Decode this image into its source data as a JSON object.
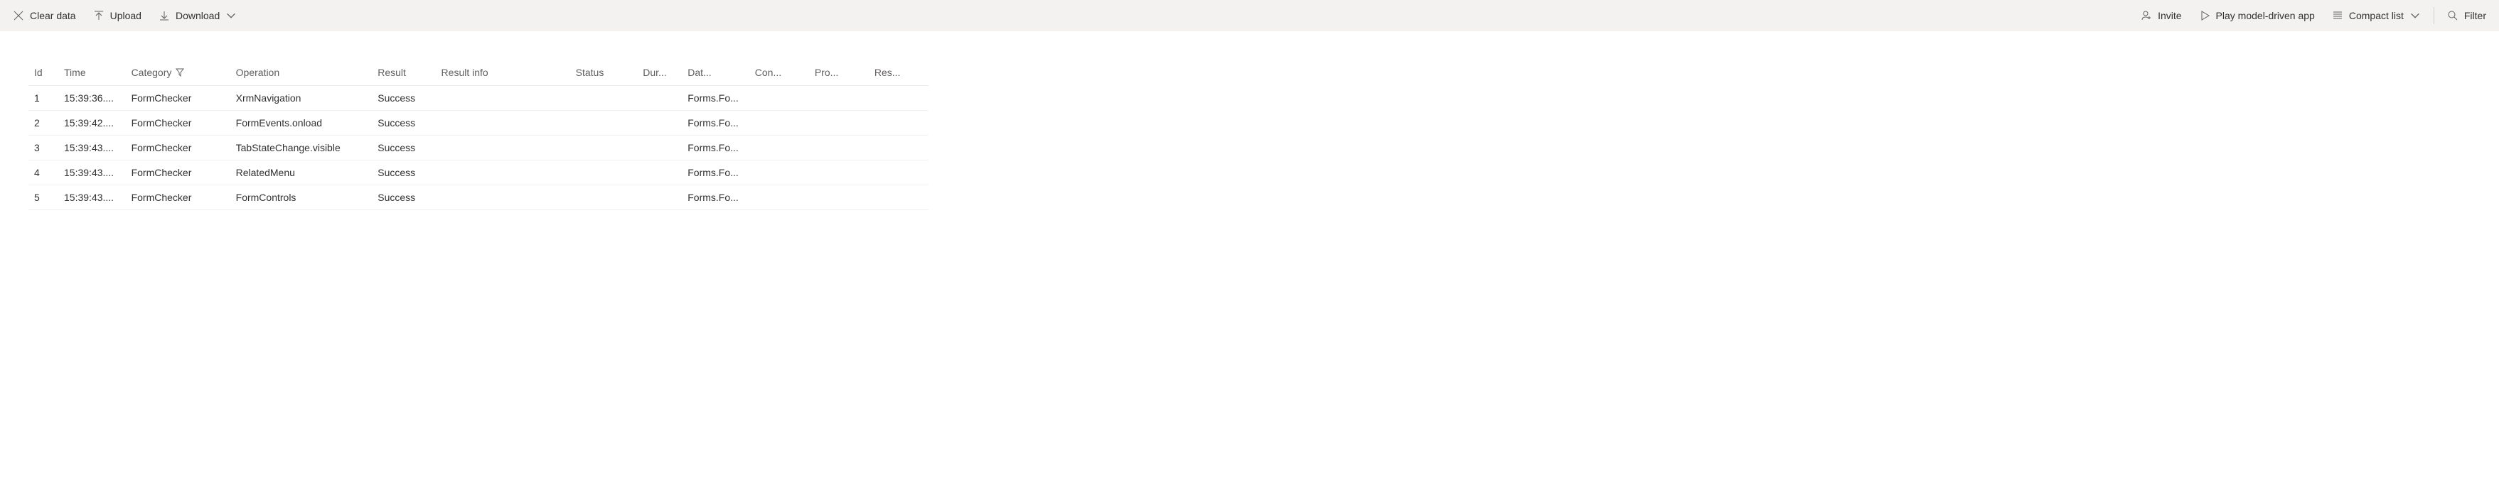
{
  "toolbar": {
    "clear_data_label": "Clear data",
    "upload_label": "Upload",
    "download_label": "Download",
    "invite_label": "Invite",
    "play_label": "Play model-driven app",
    "view_label": "Compact list",
    "filter_label": "Filter"
  },
  "table": {
    "headers": {
      "id": "Id",
      "time": "Time",
      "category": "Category",
      "operation": "Operation",
      "result": "Result",
      "result_info": "Result info",
      "status": "Status",
      "duration": "Dur...",
      "data": "Dat...",
      "con": "Con...",
      "pro": "Pro...",
      "res": "Res..."
    },
    "rows": [
      {
        "id": "1",
        "time": "15:39:36....",
        "category": "FormChecker",
        "operation": "XrmNavigation",
        "result": "Success",
        "result_info": "",
        "status": "",
        "duration": "",
        "data": "Forms.Fo...",
        "con": "",
        "pro": "",
        "res": ""
      },
      {
        "id": "2",
        "time": "15:39:42....",
        "category": "FormChecker",
        "operation": "FormEvents.onload",
        "result": "Success",
        "result_info": "",
        "status": "",
        "duration": "",
        "data": "Forms.Fo...",
        "con": "",
        "pro": "",
        "res": ""
      },
      {
        "id": "3",
        "time": "15:39:43....",
        "category": "FormChecker",
        "operation": "TabStateChange.visible",
        "result": "Success",
        "result_info": "",
        "status": "",
        "duration": "",
        "data": "Forms.Fo...",
        "con": "",
        "pro": "",
        "res": ""
      },
      {
        "id": "4",
        "time": "15:39:43....",
        "category": "FormChecker",
        "operation": "RelatedMenu",
        "result": "Success",
        "result_info": "",
        "status": "",
        "duration": "",
        "data": "Forms.Fo...",
        "con": "",
        "pro": "",
        "res": ""
      },
      {
        "id": "5",
        "time": "15:39:43....",
        "category": "FormChecker",
        "operation": "FormControls",
        "result": "Success",
        "result_info": "",
        "status": "",
        "duration": "",
        "data": "Forms.Fo...",
        "con": "",
        "pro": "",
        "res": ""
      }
    ]
  }
}
